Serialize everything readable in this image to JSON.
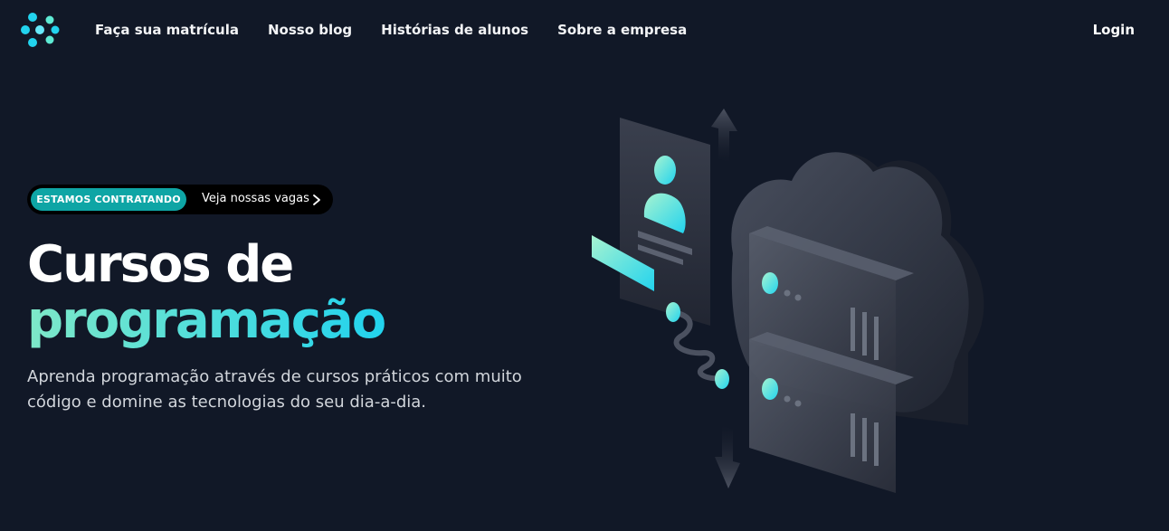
{
  "nav": {
    "logo_icon": "brand-logo",
    "links": [
      {
        "label": "Faça sua matrícula"
      },
      {
        "label": "Nosso blog"
      },
      {
        "label": "Histórias de alunos"
      },
      {
        "label": "Sobre a empresa"
      }
    ],
    "login_label": "Login"
  },
  "hero": {
    "badge": "ESTAMOS CONTRATANDO",
    "badge_link": "Veja nossas vagas",
    "badge_icon": "chevron-right-icon",
    "title_line1": "Cursos de",
    "title_line2": "programação",
    "subtitle": "Aprenda programação através de cursos práticos com muito código e domine as tecnologias do seu dia-a-dia."
  },
  "colors": {
    "background": "#111827",
    "accent": "#22d3ee",
    "accent_alt": "#7ee8c8",
    "badge_bg": "#0ea5a5"
  },
  "illustration": {
    "icon": "cloud-server-illustration"
  }
}
